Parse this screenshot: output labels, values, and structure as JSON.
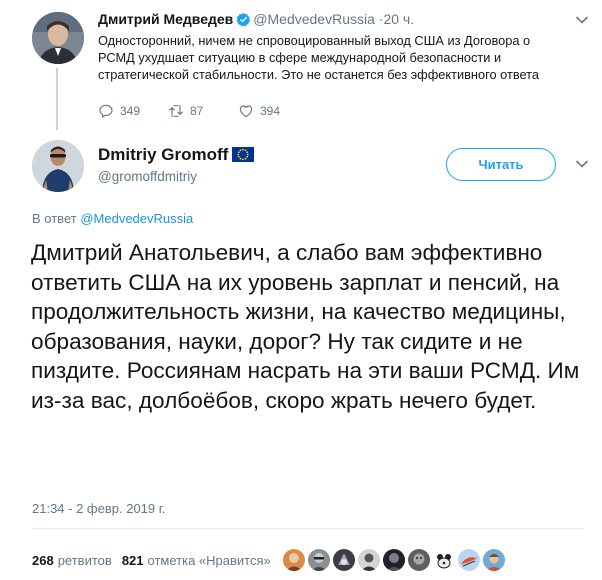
{
  "parent_tweet": {
    "author_name": "Дмитрий Медведев",
    "author_handle": "@MedvedevRussia",
    "time": "·20 ч.",
    "text": "Односторонний, ничем не спровоцированный выход США из Договора о РСМД ухудшает ситуацию в сфере международной безопасности и стратегической стабильности. Это не останется без эффективного ответа",
    "replies": "349",
    "retweets": "87",
    "likes": "394"
  },
  "main_tweet": {
    "author_name": "Dmitriy Gromoff",
    "author_handle": "@gromoffdmitriy",
    "follow_label": "Читать",
    "reply_prefix": "В ответ",
    "reply_to": "@MedvedevRussia",
    "text": "Дмитрий Анатольевич, а слабо вам эффективно ответить США на их уровень зарплат и пенсий, на продолжительность жизни, на качество медицины, образования, науки, дорог? Ну так сидите и не пиздите. Россиянам насрать на эти ваши РСМД. Им из-за вас, долбоёбов, скоро жрать нечего будет.",
    "timestamp": "21:34 - 2 февр. 2019 г.",
    "retweet_count": "268",
    "retweet_label": "ретвитов",
    "like_count": "821",
    "like_label": "отметка «Нравится»"
  },
  "colors": {
    "accent": "#1da1f2",
    "verified": "#1da1f2",
    "secondary_text": "#657786",
    "eu_flag": "#003399"
  }
}
